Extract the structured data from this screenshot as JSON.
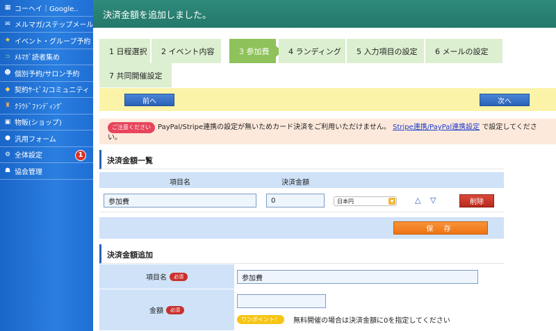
{
  "sidebar": {
    "items": [
      {
        "label": "コーヘイ｜Google..",
        "icon": "calendar-icon"
      },
      {
        "label": "メルマガ/ステップメール",
        "icon": "mail-icon"
      },
      {
        "label": "イベント・グループ予約",
        "icon": "star-icon"
      },
      {
        "label": "ﾒﾙﾏｶﾞ読者集め",
        "icon": "magnet-icon"
      },
      {
        "label": "個別予約/サロン予約",
        "icon": "people-icon"
      },
      {
        "label": "契約ｻｰﾋﾞｽ/コミュニティ",
        "icon": "contract-icon"
      },
      {
        "label": "ｸﾗｳﾄﾞﾌｧﾝﾃﾞｨﾝｸﾞ",
        "icon": "crowdfunding-icon"
      },
      {
        "label": "物販(ショップ)",
        "icon": "shop-icon"
      },
      {
        "label": "汎用フォーム",
        "icon": "form-icon"
      },
      {
        "label": "全体設定",
        "icon": "gear-icon",
        "badge": "1"
      },
      {
        "label": "協会管理",
        "icon": "group-icon"
      }
    ]
  },
  "header": {
    "message": "決済金額を追加しました。"
  },
  "steps": [
    "1 日程選択",
    "2 イベント内容",
    "3 参加費",
    "4 ランディング",
    "5 入力項目の設定",
    "6 メールの設定",
    "7 共同開催設定"
  ],
  "nav": {
    "prev": "前へ",
    "next": "次へ"
  },
  "notice": {
    "tag": "ご注意ください",
    "text1": "PayPal/Stripe連携の設定が無いためカード決済をご利用いただけません。",
    "link": "Stripe連携/PayPal連携設定",
    "text2": "で設定してください。"
  },
  "list": {
    "title": "決済金額一覧",
    "col_item": "項目名",
    "col_amount": "決済金額",
    "row": {
      "item": "参加費",
      "amount": "0",
      "currency": "日本円",
      "delete": "削除"
    },
    "save": "保 存"
  },
  "add": {
    "title": "決済金額追加",
    "item_label": "項目名",
    "item_value": "参加費",
    "amount_label": "金額",
    "required": "必須",
    "hint_tag": "ワンポイント！",
    "hint_text": "無料開催の場合は決済金額に0を指定してください"
  },
  "colors": {
    "accent": "#2a62b8",
    "header": "#2f8a7a",
    "active_step": "#8fc25a"
  }
}
